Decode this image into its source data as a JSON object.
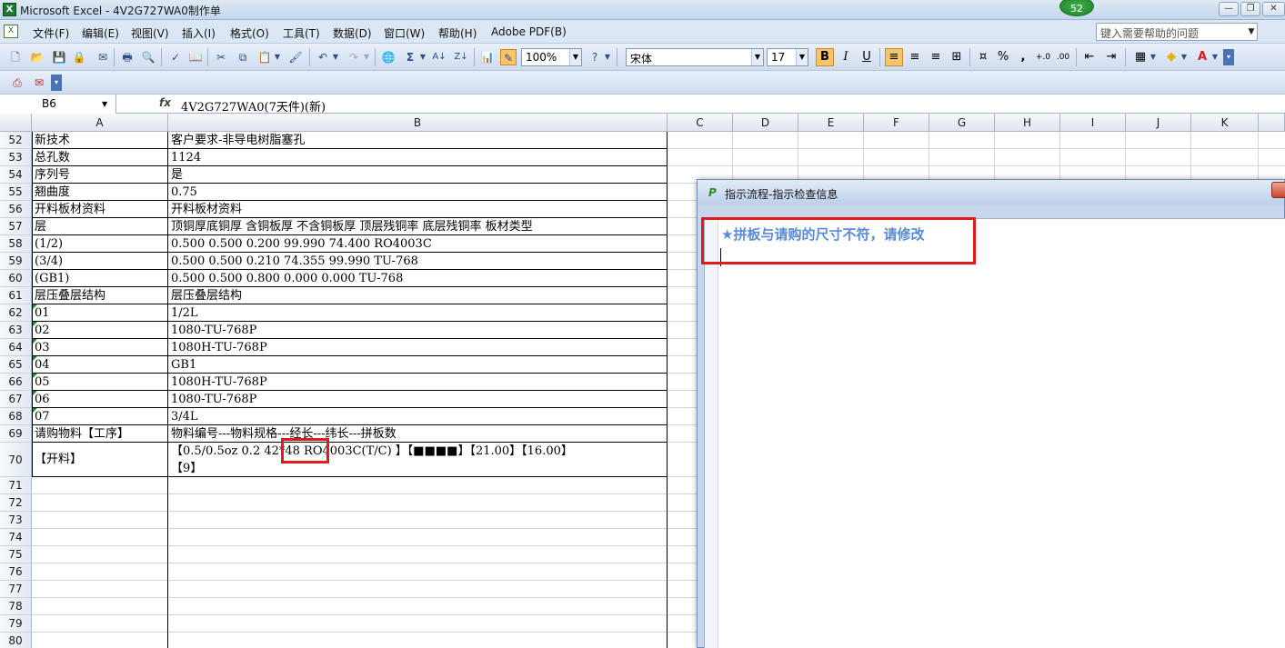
{
  "window": {
    "title": "Microsoft Excel - 4V2G727WA0制作单",
    "notification_count": "52"
  },
  "menu": {
    "items": [
      "文件(F)",
      "编辑(E)",
      "视图(V)",
      "插入(I)",
      "格式(O)",
      "工具(T)",
      "数据(D)",
      "窗口(W)",
      "帮助(H)",
      "Adobe PDF(B)"
    ],
    "help_placeholder": "键入需要帮助的问题"
  },
  "toolbar": {
    "zoom": "100%",
    "font_name": "宋体",
    "font_size": "17",
    "bold": "B",
    "italic": "I",
    "underline": "U",
    "percent": "%",
    "comma": ","
  },
  "formula_bar": {
    "cell_ref": "B6",
    "fx": "fx",
    "content": "4V2G727WA0(7天件)(新)"
  },
  "columns": [
    "A",
    "B",
    "C",
    "D",
    "E",
    "F",
    "G",
    "H",
    "I",
    "J",
    "K"
  ],
  "rows": [
    {
      "num": "52",
      "a": "新技术",
      "b": "客户要求-非导电树脂塞孔"
    },
    {
      "num": "53",
      "a": "总孔数",
      "b": "1124"
    },
    {
      "num": "54",
      "a": "序列号",
      "b": "是"
    },
    {
      "num": "55",
      "a": "翘曲度",
      "b": "0.75"
    },
    {
      "num": "56",
      "a": "开料板材资料",
      "b": "开料板材资料"
    },
    {
      "num": "57",
      "a": "层",
      "b": "顶铜厚底铜厚 含铜板厚 不含铜板厚 顶层残铜率 底层残铜率 板材类型"
    },
    {
      "num": "58",
      "a": "(1/2)",
      "b": "0.500  0.500             0.200      99.990     74.400       RO4003C"
    },
    {
      "num": "59",
      "a": "(3/4)",
      "b": "0.500  0.500             0.210      74.355     99.990       TU-768"
    },
    {
      "num": "60",
      "a": "(GB1)",
      "b": "0.500  0.500             0.800      0.000      0.000        TU-768"
    },
    {
      "num": "61",
      "a": "层压叠层结构",
      "b": "层压叠层结构"
    },
    {
      "num": "62",
      "a": "01",
      "b": "1/2L"
    },
    {
      "num": "63",
      "a": "02",
      "b": "1080-TU-768P"
    },
    {
      "num": "64",
      "a": "03",
      "b": "1080H-TU-768P"
    },
    {
      "num": "65",
      "a": "04",
      "b": "GB1"
    },
    {
      "num": "66",
      "a": "05",
      "b": "1080H-TU-768P"
    },
    {
      "num": "67",
      "a": "06",
      "b": "1080-TU-768P"
    },
    {
      "num": "68",
      "a": "07",
      "b": "3/4L"
    },
    {
      "num": "69",
      "a": "请购物料【工序】",
      "b": "物料编号---物料规格---经长---纬长---拼板数"
    },
    {
      "num": "70",
      "a": "【开料】",
      "b": "【0.5/0.5oz 0.2 42*48 RO4003C(T/C) 】【■■■■】【21.00】【16.00】",
      "b2": "【9】"
    },
    {
      "num": "71",
      "a": "",
      "b": ""
    },
    {
      "num": "72",
      "a": "",
      "b": ""
    },
    {
      "num": "73",
      "a": "",
      "b": ""
    },
    {
      "num": "74",
      "a": "",
      "b": ""
    },
    {
      "num": "75",
      "a": "",
      "b": ""
    },
    {
      "num": "76",
      "a": "",
      "b": ""
    },
    {
      "num": "77",
      "a": "",
      "b": ""
    },
    {
      "num": "78",
      "a": "",
      "b": ""
    },
    {
      "num": "79",
      "a": "",
      "b": ""
    },
    {
      "num": "80",
      "a": "",
      "b": ""
    }
  ],
  "dialog": {
    "title": "指示流程-指示检查信息",
    "message": "★拼板与请购的尺寸不符，请修改"
  },
  "colors": {
    "highlight_red": "#e01b1b",
    "message_blue": "#5a8bd6",
    "comment_green": "#148a2a"
  }
}
